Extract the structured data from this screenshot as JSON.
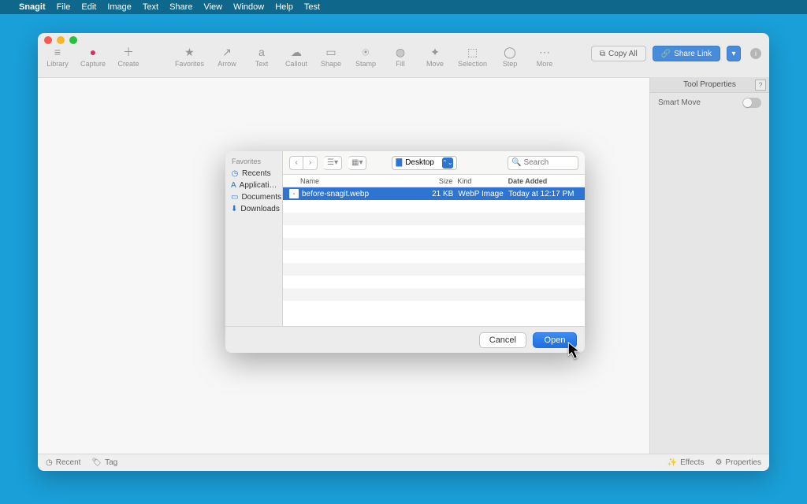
{
  "menubar": {
    "app": "Snagit",
    "items": [
      "File",
      "Edit",
      "Image",
      "Text",
      "Share",
      "View",
      "Window",
      "Help",
      "Test"
    ]
  },
  "app_toolbar": {
    "left": [
      {
        "icon": "≡",
        "label": "Library"
      },
      {
        "icon": "●",
        "label": "Capture"
      },
      {
        "icon": "＋",
        "label": "Create"
      }
    ],
    "center": [
      {
        "icon": "★",
        "label": "Favorites"
      },
      {
        "icon": "↗",
        "label": "Arrow"
      },
      {
        "icon": "a",
        "label": "Text"
      },
      {
        "icon": "☁",
        "label": "Callout"
      },
      {
        "icon": "▭",
        "label": "Shape"
      },
      {
        "icon": "⍟",
        "label": "Stamp"
      },
      {
        "icon": "◍",
        "label": "Fill"
      },
      {
        "icon": "✦",
        "label": "Move"
      },
      {
        "icon": "⬚",
        "label": "Selection"
      },
      {
        "icon": "◯",
        "label": "Step"
      }
    ],
    "more_label": "More",
    "copy_all": "Copy All",
    "share_link": "Share Link"
  },
  "props": {
    "title": "Tool Properties",
    "row1": "Smart Move"
  },
  "statusbar": {
    "recent": "Recent",
    "tag": "Tag",
    "effects": "Effects",
    "properties": "Properties"
  },
  "dialog": {
    "favorites_header": "Favorites",
    "favorites": [
      {
        "icon": "◷",
        "label": "Recents"
      },
      {
        "icon": "A",
        "label": "Applicati…"
      },
      {
        "icon": "▭",
        "label": "Documents"
      },
      {
        "icon": "⬇",
        "label": "Downloads"
      }
    ],
    "path_label": "Desktop",
    "search_placeholder": "Search",
    "columns": {
      "name": "Name",
      "size": "Size",
      "kind": "Kind",
      "date": "Date Added"
    },
    "rows": [
      {
        "name": "before-snagit.webp",
        "size": "21 KB",
        "kind": "WebP Image",
        "date": "Today at 12:17 PM",
        "selected": true
      }
    ],
    "cancel": "Cancel",
    "open": "Open"
  }
}
